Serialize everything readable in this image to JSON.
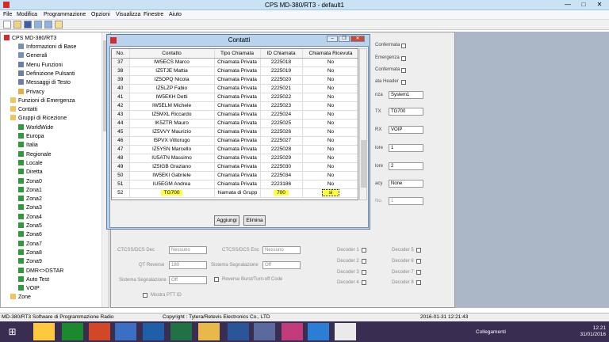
{
  "app": {
    "title": "CPS MD-380/RT3 - default1",
    "minimize": "—",
    "maximize": "□",
    "close": "✕"
  },
  "menu": [
    "File",
    "Modifica",
    "Programmazione",
    "Opzioni",
    "Visualizza",
    "Finestre",
    "Aiuto"
  ],
  "toolbar_icons": [
    "new-file-icon",
    "open-folder-icon",
    "save-icon",
    "read-radio-icon",
    "write-radio-icon",
    "key-icon"
  ],
  "tree": {
    "root": "CPS MD-380/RT3",
    "nodes": [
      {
        "label": "Informazioni di Base",
        "level": 2,
        "icon": "gear-icon"
      },
      {
        "label": "Generali",
        "level": 2,
        "icon": "gear-icon"
      },
      {
        "label": "Menu Funzioni",
        "level": 2,
        "icon": "menu-icon"
      },
      {
        "label": "Definizione Pulsanti",
        "level": 2,
        "icon": "button-icon"
      },
      {
        "label": "Messaggi di Testo",
        "level": 2,
        "icon": "message-icon"
      },
      {
        "label": "Privacy",
        "level": 2,
        "icon": "key-icon"
      },
      {
        "label": "Funzioni di Emergenza",
        "level": 1,
        "icon": "folder-icon"
      },
      {
        "label": "Contatti",
        "level": 1,
        "icon": "folder-icon"
      },
      {
        "label": "Gruppi di Ricezione",
        "level": 1,
        "icon": "folder-icon"
      },
      {
        "label": "WorldWide",
        "level": 2,
        "icon": "group-icon"
      },
      {
        "label": "Europa",
        "level": 2,
        "icon": "group-icon"
      },
      {
        "label": "Italia",
        "level": 2,
        "icon": "group-icon"
      },
      {
        "label": "Regionale",
        "level": 2,
        "icon": "group-icon"
      },
      {
        "label": "Locale",
        "level": 2,
        "icon": "group-icon"
      },
      {
        "label": "Diretta",
        "level": 2,
        "icon": "group-icon"
      },
      {
        "label": "Zona0",
        "level": 2,
        "icon": "group-icon"
      },
      {
        "label": "Zona1",
        "level": 2,
        "icon": "group-icon"
      },
      {
        "label": "Zona2",
        "level": 2,
        "icon": "group-icon"
      },
      {
        "label": "Zona3",
        "level": 2,
        "icon": "group-icon"
      },
      {
        "label": "Zona4",
        "level": 2,
        "icon": "group-icon"
      },
      {
        "label": "Zona5",
        "level": 2,
        "icon": "group-icon"
      },
      {
        "label": "Zona6",
        "level": 2,
        "icon": "group-icon"
      },
      {
        "label": "Zona7",
        "level": 2,
        "icon": "group-icon"
      },
      {
        "label": "Zona8",
        "level": 2,
        "icon": "group-icon"
      },
      {
        "label": "Zona9",
        "level": 2,
        "icon": "group-icon"
      },
      {
        "label": "DMR<>DSTAR",
        "level": 2,
        "icon": "group-icon"
      },
      {
        "label": "Auto Test",
        "level": 2,
        "icon": "group-icon"
      },
      {
        "label": "VOIP",
        "level": 2,
        "icon": "group-icon"
      },
      {
        "label": "Zone",
        "level": 1,
        "icon": "folder-icon"
      }
    ]
  },
  "background_form": {
    "right_labels": [
      "Confermata",
      "Emergenza",
      "Confermata",
      "ata Header",
      "nza",
      "TX",
      "RX",
      "lore",
      "lore",
      "acy",
      "No."
    ],
    "right_selects": [
      "System1",
      "TG700",
      "VOIP",
      "1",
      "2",
      "None",
      "1"
    ],
    "ctcss_dec_label": "CTCSS/DCS Dec",
    "ctcss_dec_value": "Nessuno",
    "ctcss_enc_label": "CTCSS/DCS Enc",
    "ctcss_enc_value": "Nessuno",
    "qt_reverse_label": "QT Reverse",
    "qt_reverse_value": "180",
    "sistema_sig_label": "Sistema Segnalazione",
    "sistema_sig_value": "Off",
    "sistema_sig2_label": "Sistema Segnalazione",
    "sistema_sig2_value": "Off",
    "reverse_burst_label": "Reverse Burst/Turn-off Code",
    "mostra_ptt_label": "Mostra PTT ID",
    "decoders": [
      "Decoder 1",
      "Decoder 2",
      "Decoder 3",
      "Decoder 4",
      "Decoder 5",
      "Decoder 6",
      "Decoder 7",
      "Decoder 8"
    ]
  },
  "dialog": {
    "title": "Contatti",
    "columns": [
      "No.",
      "Contatto",
      "Tipo Chiamata",
      "ID Chiamata",
      "Chiamata Ricevuta"
    ],
    "rows": [
      [
        "37",
        "IW5ECS Marco",
        "Chiamata Privata",
        "2225018",
        "No"
      ],
      [
        "38",
        "IZ5TJE Mattia",
        "Chiamata Privata",
        "2225019",
        "No"
      ],
      [
        "39",
        "IZ5OPQ Nicola",
        "Chiamata Privata",
        "2225020",
        "No"
      ],
      [
        "40",
        "IZ5LZP Fabio",
        "Chiamata Privata",
        "2225021",
        "No"
      ],
      [
        "41",
        "IW5EKH Detti",
        "Chiamata Privata",
        "2225022",
        "No"
      ],
      [
        "42",
        "IW5ELM Michele",
        "Chiamata Privata",
        "2225023",
        "No"
      ],
      [
        "43",
        "IZ5MXL Riccardo",
        "Chiamata Privata",
        "2225024",
        "No"
      ],
      [
        "44",
        "IK5ZTR Mauro",
        "Chiamata Privata",
        "2225025",
        "No"
      ],
      [
        "45",
        "IZ5VVY Maurizio",
        "Chiamata Privata",
        "2225026",
        "No"
      ],
      [
        "46",
        "I5PVX Vittorugo",
        "Chiamata Privata",
        "2225027",
        "No"
      ],
      [
        "47",
        "IZ5YSN Marcello",
        "Chiamata Privata",
        "2225028",
        "No"
      ],
      [
        "48",
        "IU5ATN Massimo",
        "Chiamata Privata",
        "2225029",
        "No"
      ],
      [
        "49",
        "IZ5IGB Graziano",
        "Chiamata Privata",
        "2225030",
        "No"
      ],
      [
        "50",
        "IW5EKI Gabriele",
        "Chiamata Privata",
        "2225034",
        "No"
      ],
      [
        "51",
        "IU5EGM Andrea",
        "Chiamata Privata",
        "2223186",
        "No"
      ]
    ],
    "new_row": [
      "52",
      "TG700",
      "hiamata di Grupp",
      "700",
      "si"
    ],
    "add_button": "Aggiungi",
    "delete_button": "Elimina"
  },
  "statusbar": {
    "left": "MD-380/RT3 Software di Programmazione Radio",
    "center": "Copyright : Tytera/Retevis Electronics Co., LTD",
    "datetime": "2016-01-31 12:21:43"
  },
  "taskbar": {
    "network_label": "Collegamenti",
    "time": "12.21",
    "date": "31/01/2016",
    "highlight": "#ffff3a"
  }
}
